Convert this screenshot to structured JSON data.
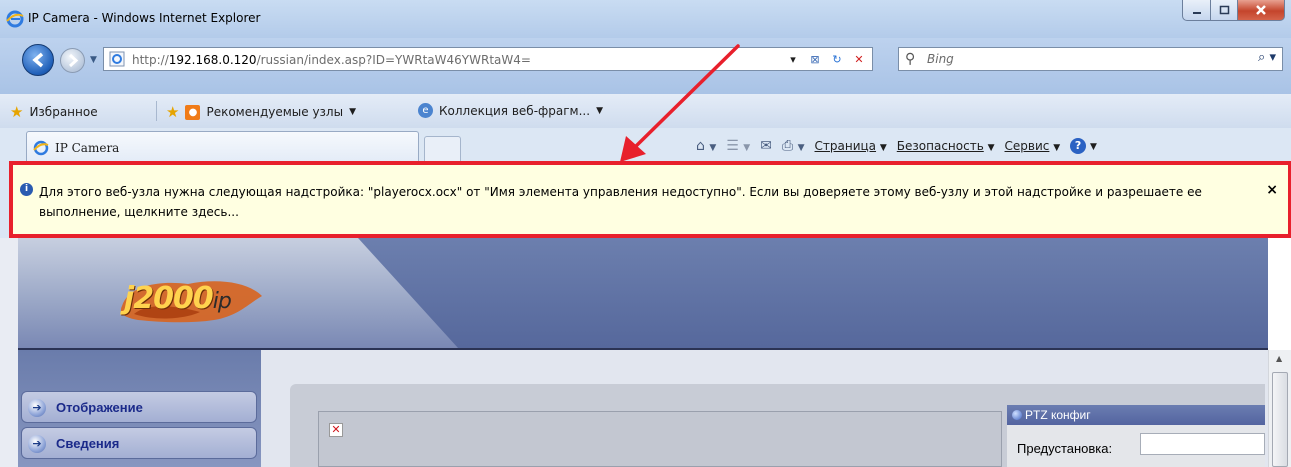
{
  "window": {
    "title": "IP Camera - Windows Internet Explorer"
  },
  "address": {
    "url_prefix": "http://",
    "url_host": "192.168.0.120",
    "url_path": "/russian/index.asp?ID=YWRtaW46YWRtaW4=",
    "search_placeholder": "Bing"
  },
  "favorites": {
    "favorites_label": "Избранное",
    "recommended_label": "Рекомендуемые узлы",
    "webslice_label": "Коллекция веб-фрагм..."
  },
  "tabs": [
    {
      "label": "IP Camera"
    }
  ],
  "commandbar": {
    "page_label": "Страница",
    "safety_label": "Безопасность",
    "tools_label": "Сервис"
  },
  "infobar": {
    "text": "Для этого веб-узла нужна следующая надстройка: \"playerocx.ocx\" от \"Имя элемента управления недоступно\". Если вы доверяете этому веб-узлу и этой надстройке и разрешаете ее выполнение, щелкните здесь...",
    "close": "×"
  },
  "page": {
    "logo_main": "j2000",
    "logo_suffix": "ip",
    "menu": [
      {
        "label": "Отображение"
      },
      {
        "label": "Сведения"
      }
    ],
    "ptz_title": "PTZ конфиг",
    "preset_label": "Предустановка:"
  },
  "colors": {
    "annotation_red": "#e8202c",
    "infobar_bg": "#ffffe1",
    "header_blue": "#5e70a3"
  }
}
